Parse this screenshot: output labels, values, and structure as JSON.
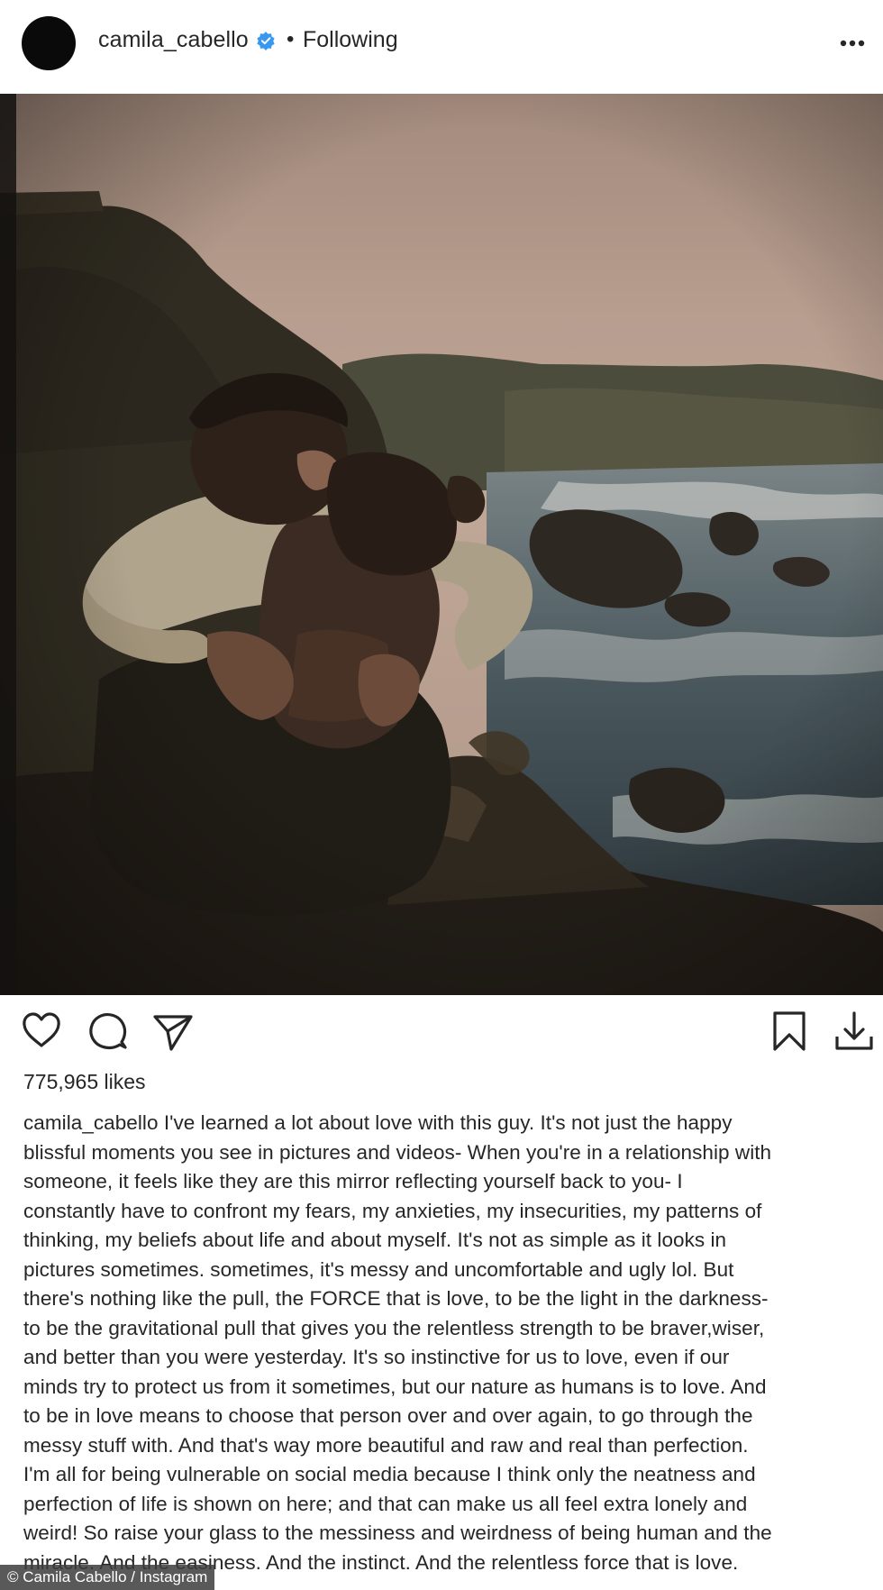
{
  "header": {
    "username": "camila_cabello",
    "separator": "•",
    "follow_status": "Following",
    "more_icon": "more-horizontal-icon",
    "verified_icon": "verified-badge-icon"
  },
  "actions": {
    "like_icon": "heart-icon",
    "comment_icon": "comment-icon",
    "share_icon": "send-icon",
    "save_icon": "bookmark-icon",
    "download_icon": "download-icon"
  },
  "likes": "775,965 likes",
  "caption": {
    "username": "camila_cabello",
    "lines": [
      " I've learned a lot about love with this guy. It's not just the happy",
      "blissful moments you see in pictures and videos- When you're in a relationship with",
      "someone, it feels like they are this mirror reflecting yourself back to you- I",
      "constantly have to confront my fears, my anxieties, my insecurities, my patterns of",
      "thinking, my beliefs about life and about myself. It's not as simple as it looks in",
      "pictures sometimes. sometimes, it's messy and uncomfortable and ugly lol. But",
      "there's nothing like the pull, the FORCE that is love, to be the light in the darkness-",
      "to be the gravitational pull that gives you the relentless strength to be braver,wiser,",
      "and better than you were yesterday. It's so instinctive for us to love, even if our",
      "minds try to protect us from it sometimes, but our nature as humans is to love. And",
      "to be in love means to choose that person over and over again, to go through the",
      "messy stuff with. And that's way more beautiful and raw and real than perfection.",
      "I'm all for being vulnerable on social media because I think only the neatness and",
      "perfection of life is shown on here; and that can make us all feel extra lonely and",
      "weird! So raise your glass to the messiness and weirdness of being human and the",
      "miracle. And the easiness. And the instinct. And the relentless force that is love."
    ]
  },
  "credit": "© Camila Cabello / Instagram",
  "colors": {
    "text": "#262626",
    "verified": "#3897f0",
    "background": "#ffffff"
  }
}
